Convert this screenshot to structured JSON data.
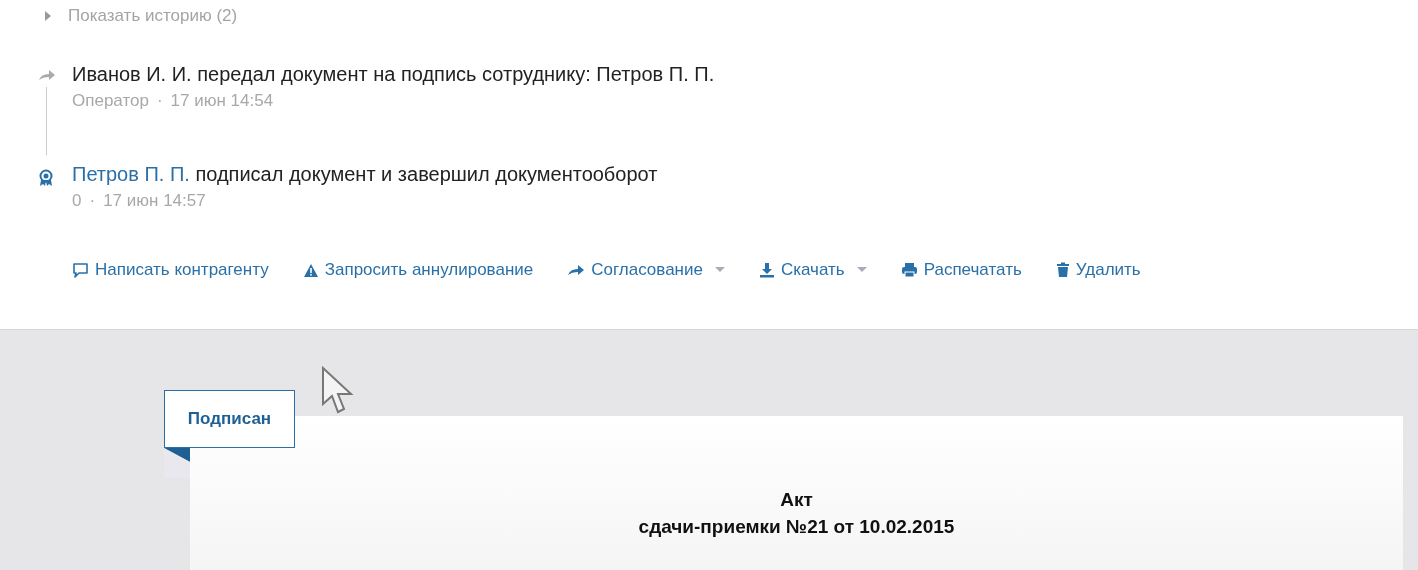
{
  "history_toggle": {
    "label": "Показать историю (2)",
    "expanded": false
  },
  "events": [
    {
      "kind": "forward",
      "actor": "Иванов И. И.",
      "actor_is_link": false,
      "text": "передал документ на подпись сотруднику: Петров П. П.",
      "author": "Оператор",
      "separator": "·",
      "time": "17 июн 14:54"
    },
    {
      "kind": "signed",
      "actor": "Петров П. П.",
      "actor_is_link": true,
      "text": "подписал документ и завершил документооборот",
      "author": "0",
      "separator": "·",
      "time": "17 июн 14:57"
    }
  ],
  "actions": [
    {
      "kind": "comment",
      "label": "Написать контрагенту",
      "dropdown": false
    },
    {
      "kind": "warning",
      "label": "Запросить аннулирование",
      "dropdown": false
    },
    {
      "kind": "forward",
      "label": "Согласование",
      "dropdown": true
    },
    {
      "kind": "download",
      "label": "Скачать",
      "dropdown": true
    },
    {
      "kind": "print",
      "label": "Распечатать",
      "dropdown": false
    },
    {
      "kind": "delete",
      "label": "Удалить",
      "dropdown": false
    }
  ],
  "document": {
    "status": "Подписан",
    "title_lines": [
      "Акт",
      "сдачи-приемки №21 от 10.02.2015"
    ]
  }
}
